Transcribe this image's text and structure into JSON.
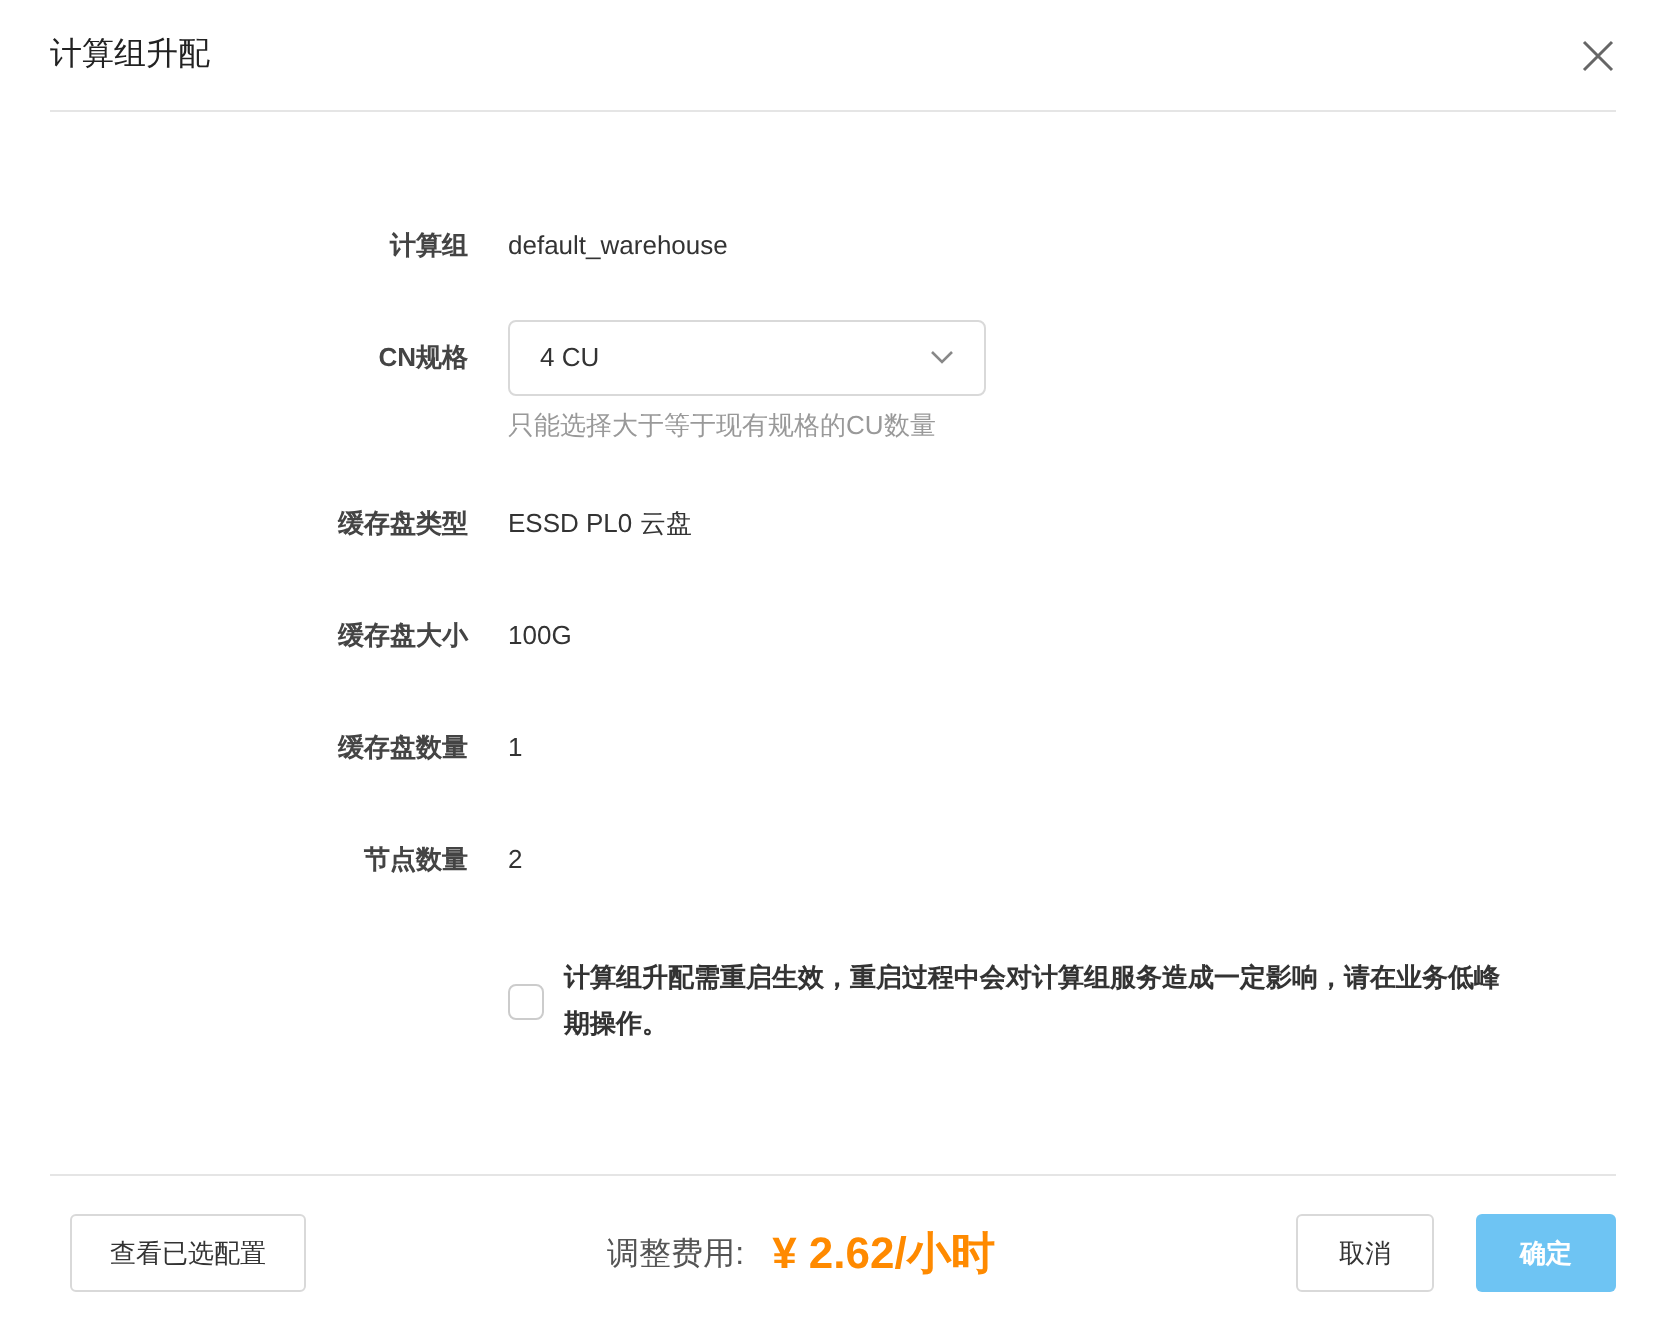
{
  "dialog": {
    "title": "计算组升配"
  },
  "fields": [
    {
      "kind": "text",
      "label": "计算组",
      "value": "default_warehouse"
    },
    {
      "kind": "select",
      "label": "CN规格",
      "value": "4 CU",
      "hint": "只能选择大于等于现有规格的CU数量"
    },
    {
      "kind": "text",
      "label": "缓存盘类型",
      "value": "ESSD PL0 云盘"
    },
    {
      "kind": "text",
      "label": "缓存盘大小",
      "value": "100G"
    },
    {
      "kind": "text",
      "label": "缓存盘数量",
      "value": "1"
    },
    {
      "kind": "text",
      "label": "节点数量",
      "value": "2"
    }
  ],
  "agreement": {
    "checked": false,
    "text": "计算组升配需重启生效，重启过程中会对计算组服务造成一定影响，请在业务低峰期操作。"
  },
  "footer": {
    "view_button": "查看已选配置",
    "fee_label": "调整费用:",
    "fee_value": "¥ 2.62/小时",
    "cancel_button": "取消",
    "confirm_button": {
      "label": "确定",
      "disabled": true
    }
  }
}
